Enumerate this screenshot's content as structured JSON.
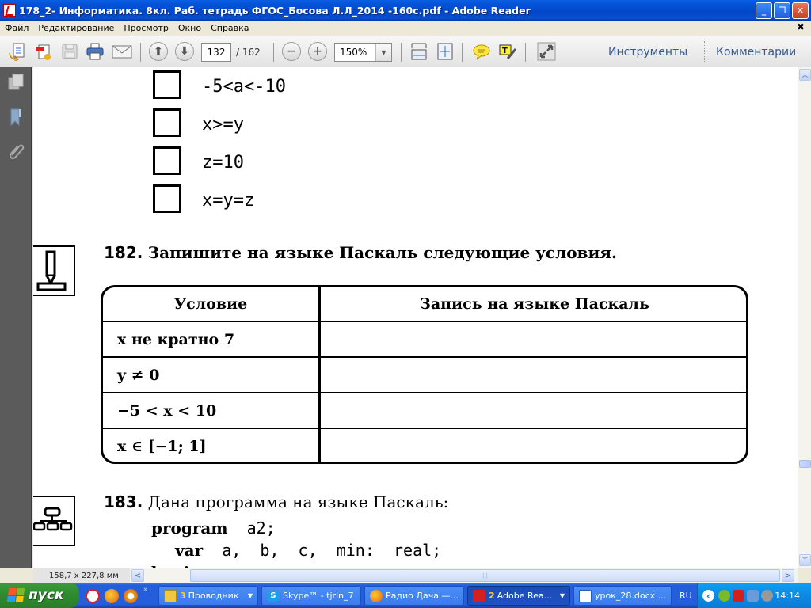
{
  "window": {
    "title": "178_2- Информатика. 8кл. Раб. тетрадь ФГОС_Босова Л.Л_2014 -160c.pdf - Adobe Reader",
    "minimize_glyph": "_",
    "restore_glyph": "❐",
    "close_glyph": "✕"
  },
  "menu": {
    "items": [
      "Файл",
      "Редактирование",
      "Просмотр",
      "Окно",
      "Справка"
    ],
    "close_glyph": "✖"
  },
  "toolbar": {
    "current_page": "132",
    "total_pages": "/ 162",
    "zoom_level": "150%",
    "tools_label": "Инструменты",
    "comments_label": "Комментарии",
    "prev_page_glyph": "⬆",
    "next_page_glyph": "⬇",
    "zoom_out_glyph": "−",
    "zoom_in_glyph": "+",
    "dropdown_glyph": "▼"
  },
  "document": {
    "checkbox_items": [
      "-5<a<-10",
      "x>=y",
      "z=10",
      "x=y=z"
    ],
    "task182": {
      "number": "182.",
      "text": "Запишите на языке Паскаль следующие условия.",
      "table": {
        "headers": [
          "Условие",
          "Запись на языке Паскаль"
        ],
        "rows": [
          {
            "condition": "x не кратно 7",
            "pascal": ""
          },
          {
            "condition": "y ≠ 0",
            "pascal": ""
          },
          {
            "condition": "−5 < x < 10",
            "pascal": ""
          },
          {
            "condition": "x ∈ [−1; 1]",
            "pascal": ""
          }
        ]
      }
    },
    "task183": {
      "number": "183.",
      "text": "Дана программа на языке Паскаль:",
      "code": [
        {
          "kw": "program",
          "rest": "  a2;"
        },
        {
          "kw": "var",
          "rest": "  a,  b,  c,  min:  real;"
        },
        {
          "kw": "begin",
          "rest": ""
        }
      ]
    }
  },
  "statusbar": {
    "page_dimensions": "158,7 x 227,8 мм",
    "hscroll_left_glyph": "<",
    "hscroll_right_glyph": ">",
    "thumb_grip": "|||"
  },
  "scrollbar": {
    "up_glyph": "︿",
    "down_glyph": "﹀"
  },
  "taskbar": {
    "start_label": "пуск",
    "more_glyph": "»",
    "tasks": [
      {
        "count": "3",
        "label": "Проводник",
        "grouped": true
      },
      {
        "count": "",
        "label": "Skype™ - tjrin_7",
        "grouped": false
      },
      {
        "count": "",
        "label": "Радио Дача —...",
        "grouped": false
      },
      {
        "count": "2",
        "label": "Adobe Rea...",
        "grouped": true,
        "active": true
      },
      {
        "count": "",
        "label": "урок_28.docx ...",
        "grouped": false
      }
    ],
    "language": "RU",
    "clock": "14:14",
    "tray_expand_glyph": "‹"
  }
}
